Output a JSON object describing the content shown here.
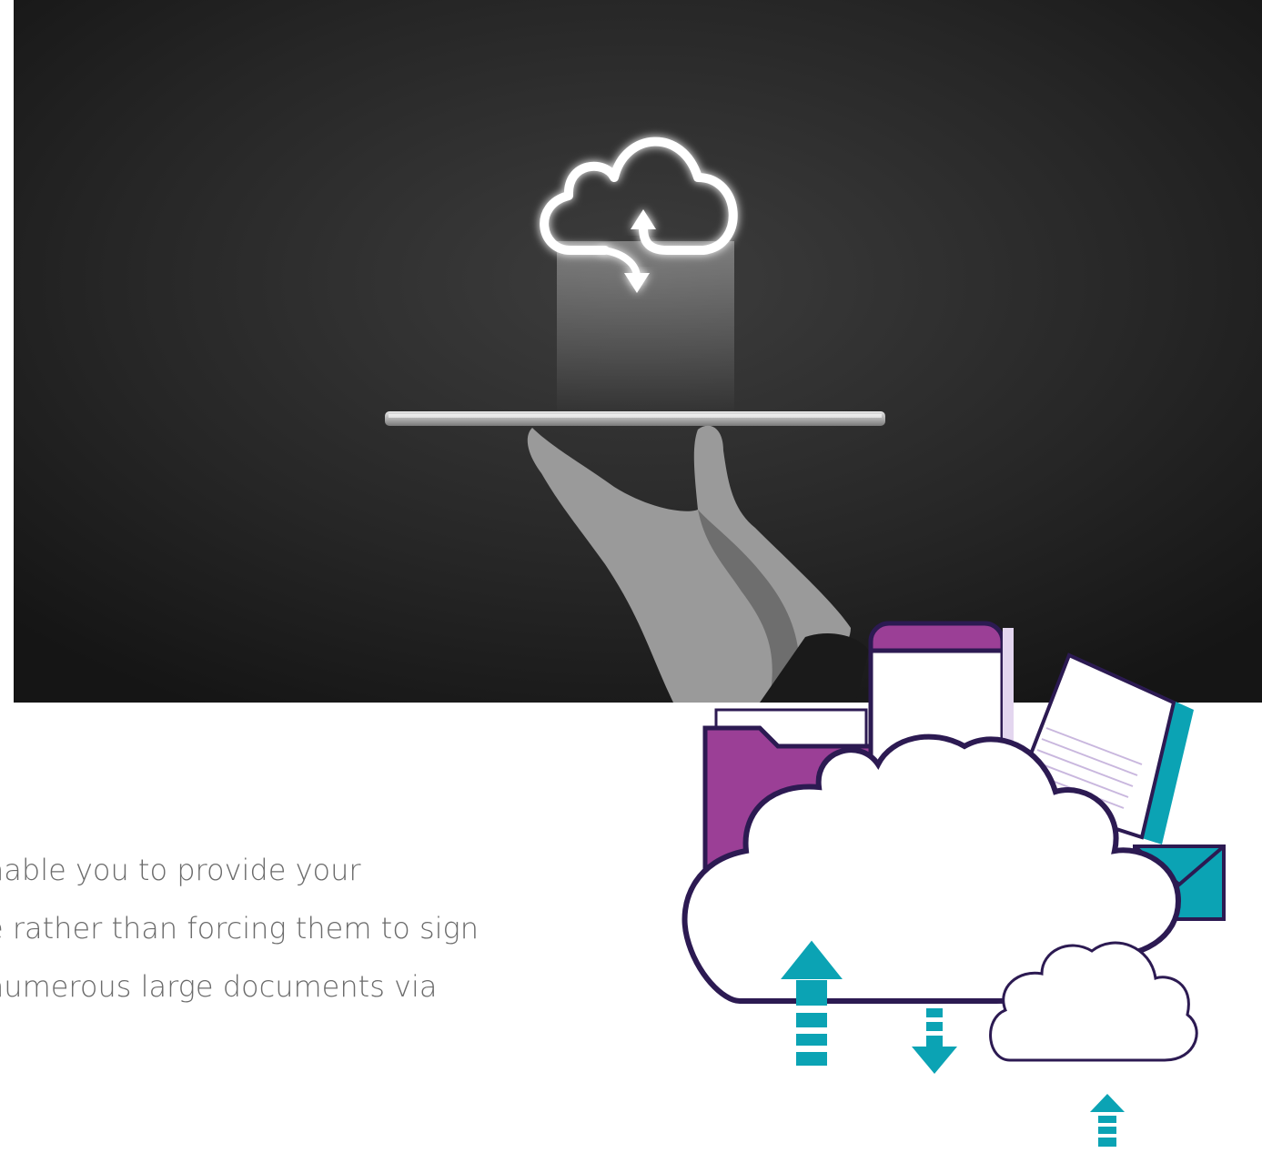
{
  "body_text": {
    "line1": "nable you to provide your",
    "line2": "e rather than forcing them to sign",
    "line3": "numerous large documents via"
  },
  "colors": {
    "purple": "#9b3f96",
    "dark_purple": "#2c1a52",
    "teal": "#0ba3b4",
    "hero_bg": "#2b2b2b"
  },
  "icons": {
    "hero": "cloud-sync-icon",
    "illustration": "cloud-storage-icon"
  }
}
